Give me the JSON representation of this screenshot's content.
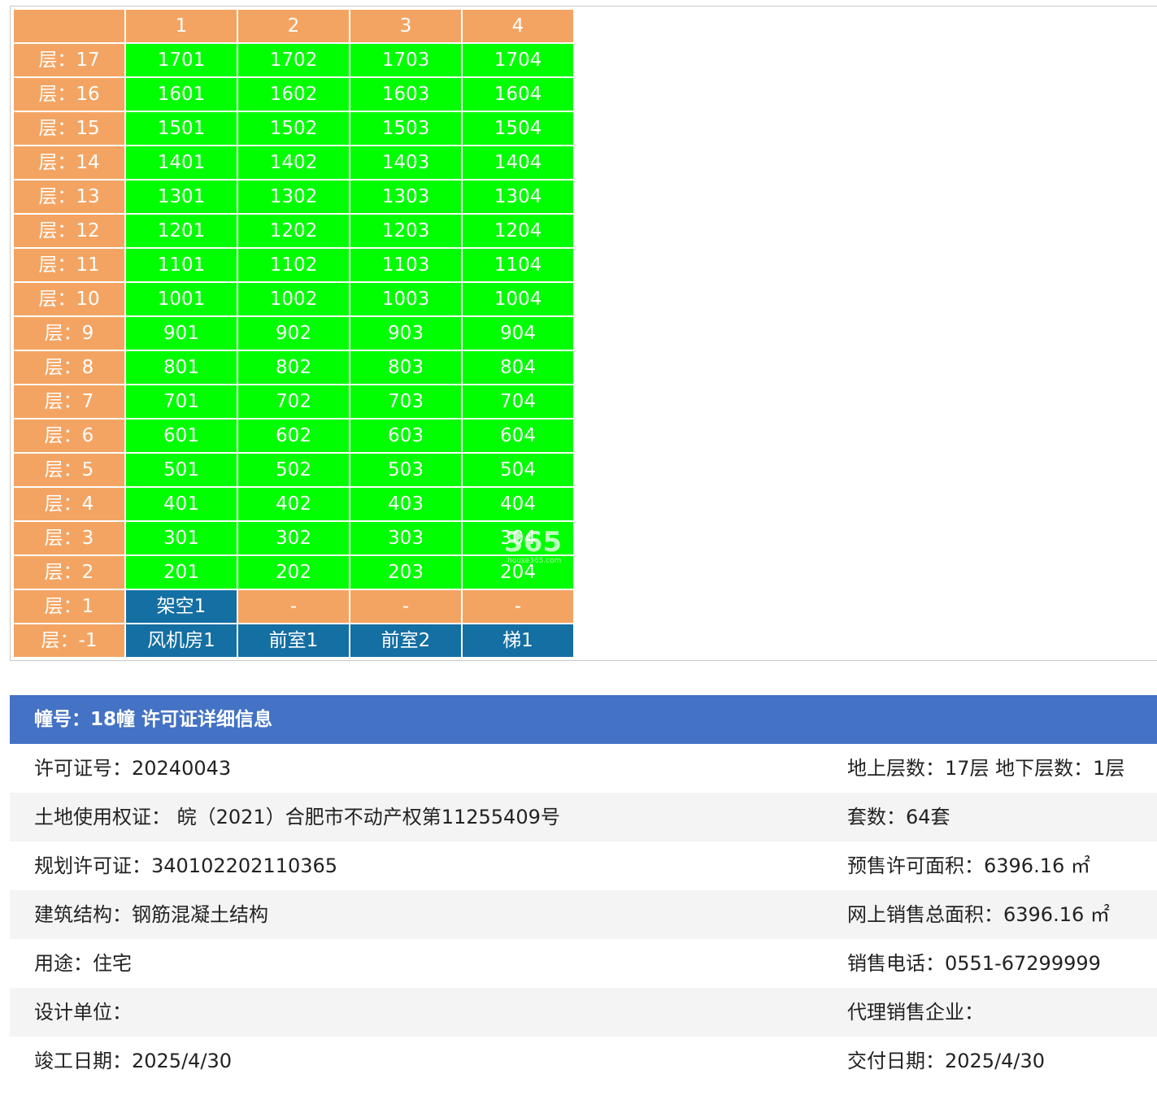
{
  "columns": [
    "1",
    "2",
    "3",
    "4"
  ],
  "floors": [
    {
      "label": "层：17",
      "units": [
        "1701",
        "1702",
        "1703",
        "1704"
      ],
      "status": [
        "unit",
        "unit",
        "unit",
        "unit"
      ]
    },
    {
      "label": "层：16",
      "units": [
        "1601",
        "1602",
        "1603",
        "1604"
      ],
      "status": [
        "unit",
        "unit",
        "unit",
        "unit"
      ]
    },
    {
      "label": "层：15",
      "units": [
        "1501",
        "1502",
        "1503",
        "1504"
      ],
      "status": [
        "unit",
        "unit",
        "unit",
        "unit"
      ]
    },
    {
      "label": "层：14",
      "units": [
        "1401",
        "1402",
        "1403",
        "1404"
      ],
      "status": [
        "unit",
        "unit",
        "unit",
        "unit"
      ]
    },
    {
      "label": "层：13",
      "units": [
        "1301",
        "1302",
        "1303",
        "1304"
      ],
      "status": [
        "unit",
        "unit",
        "unit",
        "unit"
      ]
    },
    {
      "label": "层：12",
      "units": [
        "1201",
        "1202",
        "1203",
        "1204"
      ],
      "status": [
        "unit",
        "unit",
        "unit",
        "unit"
      ]
    },
    {
      "label": "层：11",
      "units": [
        "1101",
        "1102",
        "1103",
        "1104"
      ],
      "status": [
        "unit",
        "unit",
        "unit",
        "unit"
      ]
    },
    {
      "label": "层：10",
      "units": [
        "1001",
        "1002",
        "1003",
        "1004"
      ],
      "status": [
        "unit",
        "unit",
        "unit",
        "unit"
      ]
    },
    {
      "label": "层：9",
      "units": [
        "901",
        "902",
        "903",
        "904"
      ],
      "status": [
        "unit",
        "unit",
        "unit",
        "unit"
      ]
    },
    {
      "label": "层：8",
      "units": [
        "801",
        "802",
        "803",
        "804"
      ],
      "status": [
        "unit",
        "unit",
        "unit",
        "unit"
      ]
    },
    {
      "label": "层：7",
      "units": [
        "701",
        "702",
        "703",
        "704"
      ],
      "status": [
        "unit",
        "unit",
        "unit",
        "unit"
      ]
    },
    {
      "label": "层：6",
      "units": [
        "601",
        "602",
        "603",
        "604"
      ],
      "status": [
        "unit",
        "unit",
        "unit",
        "unit"
      ]
    },
    {
      "label": "层：5",
      "units": [
        "501",
        "502",
        "503",
        "504"
      ],
      "status": [
        "unit",
        "unit",
        "unit",
        "unit"
      ]
    },
    {
      "label": "层：4",
      "units": [
        "401",
        "402",
        "403",
        "404"
      ],
      "status": [
        "unit",
        "unit",
        "unit",
        "unit"
      ]
    },
    {
      "label": "层：3",
      "units": [
        "301",
        "302",
        "303",
        "304"
      ],
      "status": [
        "unit",
        "unit",
        "unit",
        "unit"
      ]
    },
    {
      "label": "层：2",
      "units": [
        "201",
        "202",
        "203",
        "204"
      ],
      "status": [
        "unit",
        "unit",
        "unit",
        "unit"
      ]
    },
    {
      "label": "层：1",
      "units": [
        "架空1",
        "-",
        "-",
        "-"
      ],
      "status": [
        "special",
        "empty",
        "empty",
        "empty"
      ]
    },
    {
      "label": "层：-1",
      "units": [
        "风机房1",
        "前室1",
        "前室2",
        "梯1"
      ],
      "status": [
        "special",
        "special",
        "special",
        "special"
      ]
    }
  ],
  "colors": {
    "available": "#00ff00",
    "header": "#f4a462",
    "special": "#146fa3",
    "info_header": "#4472c4"
  },
  "watermark": {
    "text": "365",
    "sub": "house365.com"
  },
  "info": {
    "title": "幢号：18幢 许可证详细信息",
    "rows": [
      {
        "left": "许可证号：20240043",
        "right": "地上层数：17层  地下层数：1层"
      },
      {
        "left": "土地使用权证： 皖（2021）合肥市不动产权第11255409号",
        "right": "套数：64套"
      },
      {
        "left": "规划许可证：340102202110365",
        "right": "预售许可面积：6396.16 ㎡"
      },
      {
        "left": "建筑结构：钢筋混凝土结构",
        "right": "网上销售总面积：6396.16 ㎡"
      },
      {
        "left": "用途：住宅",
        "right": "销售电话：0551-67299999"
      },
      {
        "left": "设计单位：",
        "right": "代理销售企业："
      },
      {
        "left": "竣工日期：2025/4/30",
        "right": "交付日期：2025/4/30"
      }
    ]
  }
}
